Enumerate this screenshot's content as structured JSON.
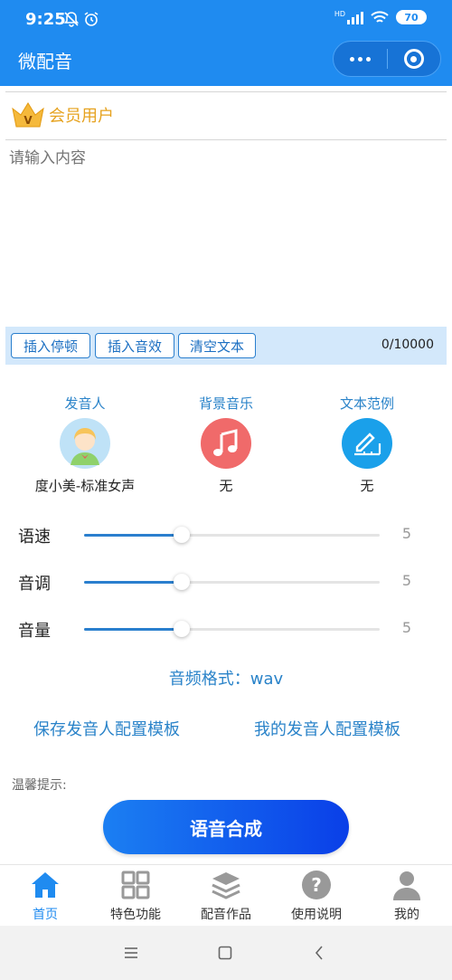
{
  "status_bar": {
    "time": "9:25",
    "battery": "70",
    "network": "HD"
  },
  "header": {
    "title": "微配音"
  },
  "member": {
    "label": "会员用户",
    "badge": "V"
  },
  "editor": {
    "placeholder": "请输入内容"
  },
  "toolbar": {
    "insert_pause": "插入停顿",
    "insert_effect": "插入音效",
    "clear_text": "清空文本",
    "counter": "0/10000"
  },
  "options": {
    "speaker": {
      "title": "发音人",
      "value": "度小美-标准女声"
    },
    "bgm": {
      "title": "背景音乐",
      "value": "无",
      "color": "#f06a6a"
    },
    "sample": {
      "title": "文本范例",
      "value": "无",
      "color": "#1aa0ea"
    }
  },
  "sliders": [
    {
      "label": "语速",
      "value": "5",
      "fraction": 0.33
    },
    {
      "label": "音调",
      "value": "5",
      "fraction": 0.33
    },
    {
      "label": "音量",
      "value": "5",
      "fraction": 0.33
    }
  ],
  "audio_format": "音频格式：wav",
  "links": {
    "save_template": "保存发音人配置模板",
    "my_templates": "我的发音人配置模板"
  },
  "tip": "温馨提示:",
  "synth_button": "语音合成",
  "tabs": [
    {
      "label": "首页",
      "icon": "home-icon",
      "active": true
    },
    {
      "label": "特色功能",
      "icon": "grid-icon",
      "active": false
    },
    {
      "label": "配音作品",
      "icon": "layers-icon",
      "active": false
    },
    {
      "label": "使用说明",
      "icon": "help-icon",
      "active": false
    },
    {
      "label": "我的",
      "icon": "user-icon",
      "active": false
    }
  ],
  "colors": {
    "primary": "#1f8bf0",
    "link": "#2a83c9",
    "member_gold": "#e6a21e"
  }
}
